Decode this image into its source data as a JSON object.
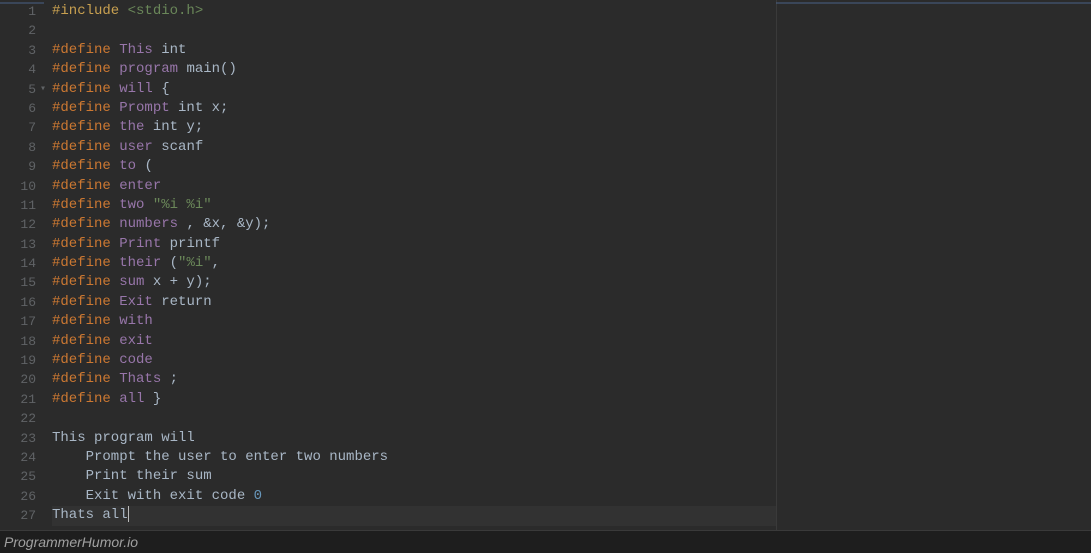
{
  "lines": [
    {
      "num": "1",
      "tokens": [
        {
          "t": "#include ",
          "c": "kw-include"
        },
        {
          "t": "<stdio.h>",
          "c": "include-path"
        }
      ]
    },
    {
      "num": "2",
      "tokens": []
    },
    {
      "num": "3",
      "tokens": [
        {
          "t": "#define ",
          "c": "kw-preproc"
        },
        {
          "t": "This ",
          "c": "macro-name"
        },
        {
          "t": "int",
          "c": "macro-body"
        }
      ]
    },
    {
      "num": "4",
      "tokens": [
        {
          "t": "#define ",
          "c": "kw-preproc"
        },
        {
          "t": "program ",
          "c": "macro-name"
        },
        {
          "t": "main()",
          "c": "macro-body"
        }
      ]
    },
    {
      "num": "5",
      "fold": true,
      "tokens": [
        {
          "t": "#define ",
          "c": "kw-preproc"
        },
        {
          "t": "will ",
          "c": "macro-name"
        },
        {
          "t": "{",
          "c": "macro-body"
        }
      ]
    },
    {
      "num": "6",
      "tokens": [
        {
          "t": "#define ",
          "c": "kw-preproc"
        },
        {
          "t": "Prompt ",
          "c": "macro-name"
        },
        {
          "t": "int x;",
          "c": "macro-body"
        }
      ]
    },
    {
      "num": "7",
      "tokens": [
        {
          "t": "#define ",
          "c": "kw-preproc"
        },
        {
          "t": "the ",
          "c": "macro-name"
        },
        {
          "t": "int y;",
          "c": "macro-body"
        }
      ]
    },
    {
      "num": "8",
      "tokens": [
        {
          "t": "#define ",
          "c": "kw-preproc"
        },
        {
          "t": "user ",
          "c": "macro-name"
        },
        {
          "t": "scanf",
          "c": "macro-body"
        }
      ]
    },
    {
      "num": "9",
      "tokens": [
        {
          "t": "#define ",
          "c": "kw-preproc"
        },
        {
          "t": "to ",
          "c": "macro-name"
        },
        {
          "t": "(",
          "c": "macro-body"
        }
      ]
    },
    {
      "num": "10",
      "tokens": [
        {
          "t": "#define ",
          "c": "kw-preproc"
        },
        {
          "t": "enter",
          "c": "macro-name"
        }
      ]
    },
    {
      "num": "11",
      "tokens": [
        {
          "t": "#define ",
          "c": "kw-preproc"
        },
        {
          "t": "two ",
          "c": "macro-name"
        },
        {
          "t": "\"%i %i\"",
          "c": "string"
        }
      ]
    },
    {
      "num": "12",
      "tokens": [
        {
          "t": "#define ",
          "c": "kw-preproc"
        },
        {
          "t": "numbers ",
          "c": "macro-name"
        },
        {
          "t": ", &x, &y);",
          "c": "macro-body"
        }
      ]
    },
    {
      "num": "13",
      "tokens": [
        {
          "t": "#define ",
          "c": "kw-preproc"
        },
        {
          "t": "Print ",
          "c": "macro-name"
        },
        {
          "t": "printf",
          "c": "macro-body"
        }
      ]
    },
    {
      "num": "14",
      "tokens": [
        {
          "t": "#define ",
          "c": "kw-preproc"
        },
        {
          "t": "their ",
          "c": "macro-name"
        },
        {
          "t": "(",
          "c": "macro-body"
        },
        {
          "t": "\"%i\"",
          "c": "string"
        },
        {
          "t": ",",
          "c": "macro-body"
        }
      ]
    },
    {
      "num": "15",
      "tokens": [
        {
          "t": "#define ",
          "c": "kw-preproc"
        },
        {
          "t": "sum ",
          "c": "macro-name"
        },
        {
          "t": "x + y);",
          "c": "macro-body"
        }
      ]
    },
    {
      "num": "16",
      "tokens": [
        {
          "t": "#define ",
          "c": "kw-preproc"
        },
        {
          "t": "Exit ",
          "c": "macro-name"
        },
        {
          "t": "return",
          "c": "macro-body"
        }
      ]
    },
    {
      "num": "17",
      "tokens": [
        {
          "t": "#define ",
          "c": "kw-preproc"
        },
        {
          "t": "with",
          "c": "macro-name"
        }
      ]
    },
    {
      "num": "18",
      "tokens": [
        {
          "t": "#define ",
          "c": "kw-preproc"
        },
        {
          "t": "exit",
          "c": "macro-name"
        }
      ]
    },
    {
      "num": "19",
      "tokens": [
        {
          "t": "#define ",
          "c": "kw-preproc"
        },
        {
          "t": "code",
          "c": "macro-name"
        }
      ]
    },
    {
      "num": "20",
      "tokens": [
        {
          "t": "#define ",
          "c": "kw-preproc"
        },
        {
          "t": "Thats ",
          "c": "macro-name"
        },
        {
          "t": ";",
          "c": "macro-body"
        }
      ]
    },
    {
      "num": "21",
      "tokens": [
        {
          "t": "#define ",
          "c": "kw-preproc"
        },
        {
          "t": "all ",
          "c": "macro-name"
        },
        {
          "t": "}",
          "c": "macro-body"
        }
      ]
    },
    {
      "num": "22",
      "tokens": []
    },
    {
      "num": "23",
      "tokens": [
        {
          "t": "This program will",
          "c": "code-text"
        }
      ]
    },
    {
      "num": "24",
      "tokens": [
        {
          "t": "    Prompt the user to enter two numbers",
          "c": "code-text"
        }
      ]
    },
    {
      "num": "25",
      "tokens": [
        {
          "t": "    Print their sum",
          "c": "code-text"
        }
      ]
    },
    {
      "num": "26",
      "tokens": [
        {
          "t": "    Exit with exit code ",
          "c": "code-text"
        },
        {
          "t": "0",
          "c": "number"
        }
      ]
    },
    {
      "num": "27",
      "active": true,
      "tokens": [
        {
          "t": "Thats all",
          "c": "code-text"
        }
      ],
      "cursor": true
    }
  ],
  "footer": {
    "watermark": "ProgrammerHumor.io"
  }
}
